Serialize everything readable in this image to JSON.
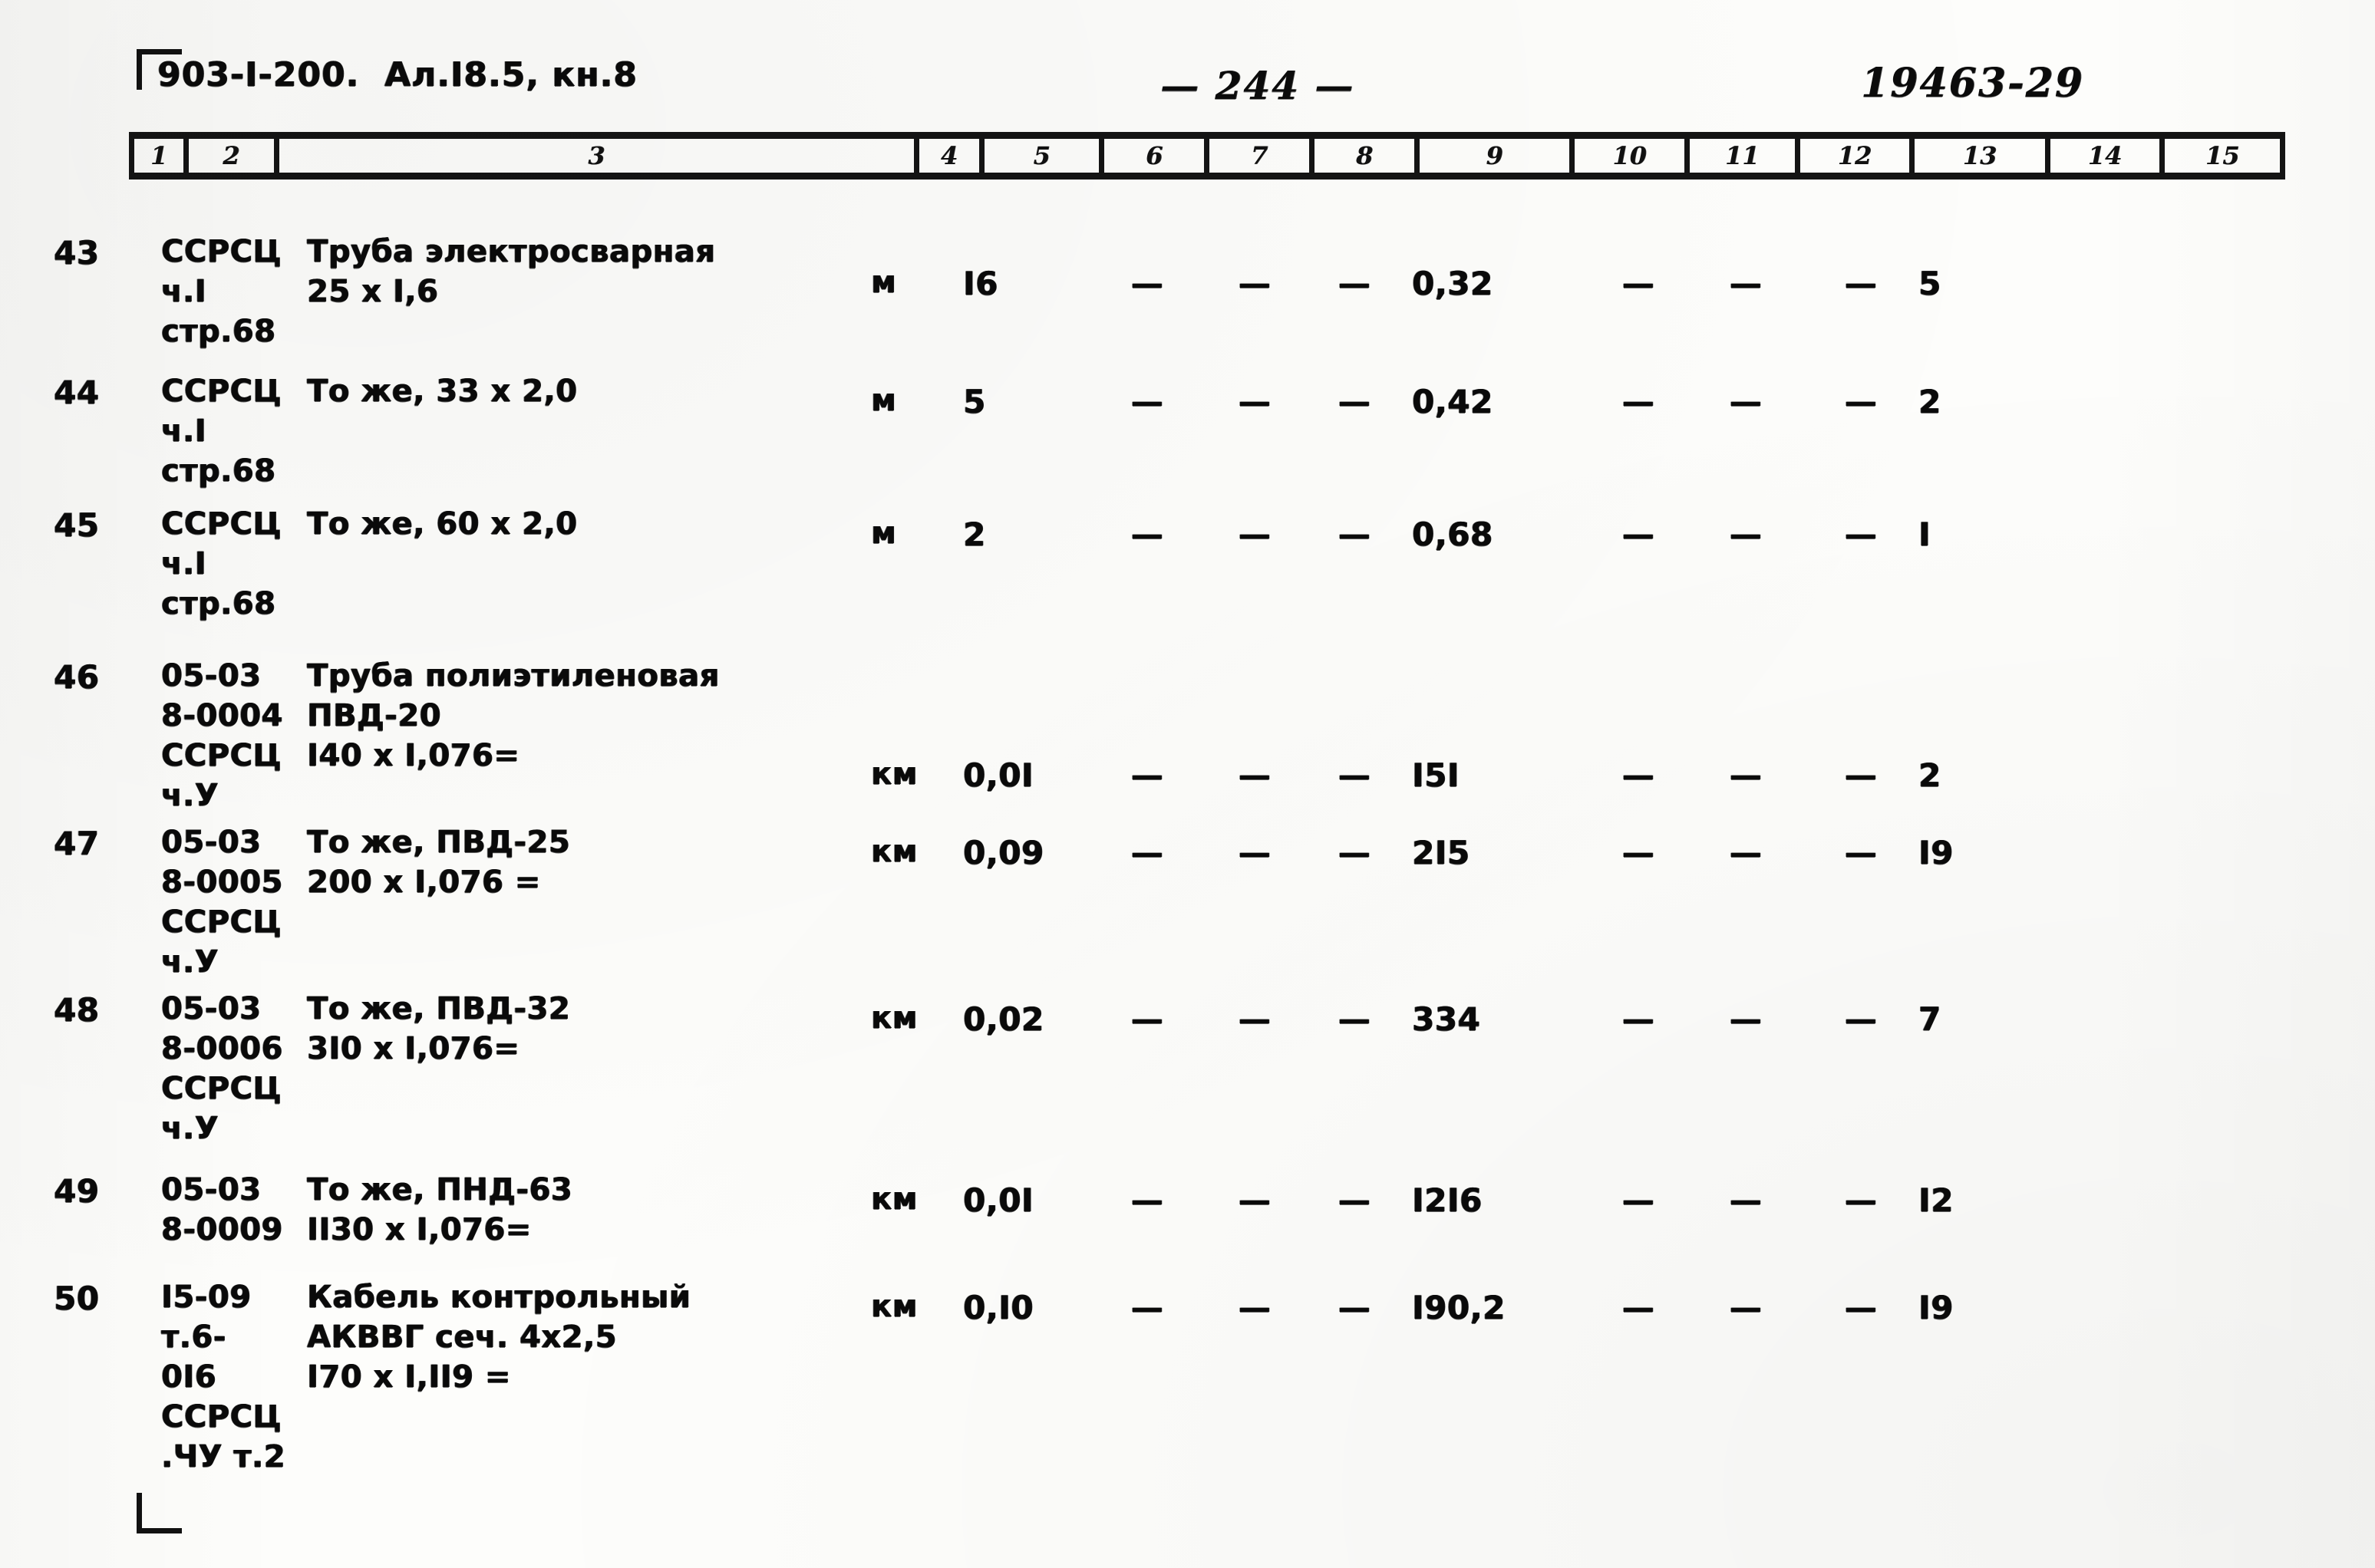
{
  "document": {
    "code": "903-I-200.  Ал.I8.5, кн.8",
    "page_number": "— 244 —",
    "archive_number": "19463-29"
  },
  "table": {
    "column_headers": [
      "1",
      "2",
      "3",
      "4",
      "5",
      "6",
      "7",
      "8",
      "9",
      "10",
      "11",
      "12",
      "13",
      "14",
      "15"
    ],
    "dash": "—",
    "rows": [
      {
        "num": "43",
        "code_lines": [
          "ССРСЦ",
          "ч.I",
          "стр.68"
        ],
        "name_lines": [
          "Труба электросварная",
          "25 x I,6"
        ],
        "unit": "м",
        "c5": "I6",
        "c6": "—",
        "c7": "—",
        "c8": "—",
        "c9": "0,32",
        "c10": "—",
        "c11": "—",
        "c12": "—",
        "c13": "5",
        "c14": "",
        "c15": ""
      },
      {
        "num": "44",
        "code_lines": [
          "ССРСЦ",
          "ч.I",
          "стр.68"
        ],
        "name_lines": [
          "То же, 33 x 2,0"
        ],
        "unit": "м",
        "c5": "5",
        "c6": "—",
        "c7": "—",
        "c8": "—",
        "c9": "0,42",
        "c10": "—",
        "c11": "—",
        "c12": "—",
        "c13": "2",
        "c14": "",
        "c15": ""
      },
      {
        "num": "45",
        "code_lines": [
          "ССРСЦ",
          "ч.I",
          "стр.68"
        ],
        "name_lines": [
          "То же, 60 x 2,0"
        ],
        "unit": "м",
        "c5": "2",
        "c6": "—",
        "c7": "—",
        "c8": "—",
        "c9": "0,68",
        "c10": "—",
        "c11": "—",
        "c12": "—",
        "c13": "I",
        "c14": "",
        "c15": ""
      },
      {
        "num": "46",
        "code_lines": [
          "05-03",
          "8-0004",
          "ССРСЦ",
          "ч.У"
        ],
        "name_lines": [
          "Труба полиэтиленовая",
          "ПВД-20",
          "I40 x I,076="
        ],
        "unit": "км",
        "c5": "0,0I",
        "c6": "—",
        "c7": "—",
        "c8": "—",
        "c9": "I5I",
        "c10": "—",
        "c11": "—",
        "c12": "—",
        "c13": "2",
        "c14": "",
        "c15": ""
      },
      {
        "num": "47",
        "code_lines": [
          "05-03",
          "8-0005",
          "ССРСЦ",
          "ч.У"
        ],
        "name_lines": [
          "То же, ПВД-25",
          "200 x I,076 ="
        ],
        "unit": "км",
        "c5": "0,09",
        "c6": "—",
        "c7": "—",
        "c8": "—",
        "c9": "2I5",
        "c10": "—",
        "c11": "—",
        "c12": "—",
        "c13": "I9",
        "c14": "",
        "c15": ""
      },
      {
        "num": "48",
        "code_lines": [
          "05-03",
          "8-0006",
          "ССРСЦ",
          "ч.У"
        ],
        "name_lines": [
          "То же, ПВД-32",
          "3I0 x I,076="
        ],
        "unit": "км",
        "c5": "0,02",
        "c6": "—",
        "c7": "—",
        "c8": "—",
        "c9": "334",
        "c10": "—",
        "c11": "—",
        "c12": "—",
        "c13": "7",
        "c14": "",
        "c15": ""
      },
      {
        "num": "49",
        "code_lines": [
          "05-03",
          "8-0009"
        ],
        "name_lines": [
          "То же, ПНД-63",
          "II30 x I,076="
        ],
        "unit": "км",
        "c5": "0,0I",
        "c6": "—",
        "c7": "—",
        "c8": "—",
        "c9": "I2I6",
        "c10": "—",
        "c11": "—",
        "c12": "—",
        "c13": "I2",
        "c14": "",
        "c15": ""
      },
      {
        "num": "50",
        "code_lines": [
          "I5-09",
          "т.6-",
          "0I6",
          "ССРСЦ",
          ".ЧУ т.2"
        ],
        "name_lines": [
          "Кабель контрольный",
          "АКВВГ сеч. 4х2,5",
          "I70 x I,II9 ="
        ],
        "unit": "км",
        "c5": "0,I0",
        "c6": "—",
        "c7": "—",
        "c8": "—",
        "c9": "I90,2",
        "c10": "—",
        "c11": "—",
        "c12": "—",
        "c13": "I9",
        "c14": "",
        "c15": ""
      }
    ]
  }
}
